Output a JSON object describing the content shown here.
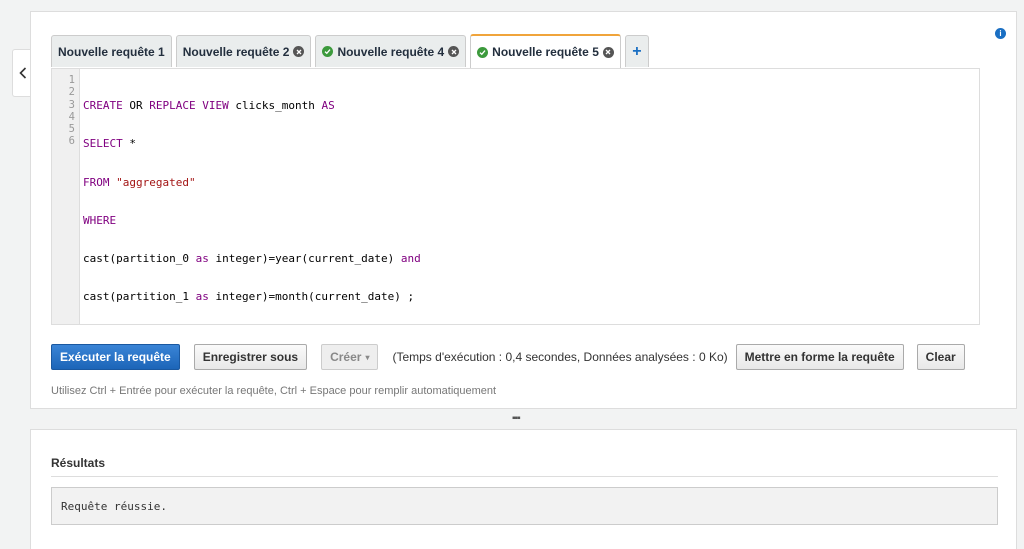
{
  "tabs": [
    {
      "label": "Nouvelle requête 1",
      "status": "none",
      "closable": false
    },
    {
      "label": "Nouvelle requête 2",
      "status": "none",
      "closable": true
    },
    {
      "label": "Nouvelle requête 4",
      "status": "success",
      "closable": true
    },
    {
      "label": "Nouvelle requête 5",
      "status": "success",
      "closable": true,
      "active": true
    }
  ],
  "add_tab_label": "+",
  "info_label": "i",
  "editor": {
    "line_numbers": [
      "1",
      "2",
      "3",
      "4",
      "5",
      "6"
    ],
    "lines": [
      "CREATE OR REPLACE VIEW clicks_month AS",
      "SELECT *",
      "FROM \"aggregated\"",
      "WHERE",
      "cast(partition_0 as integer)=year(current_date) and",
      "cast(partition_1 as integer)=month(current_date) ;"
    ]
  },
  "toolbar": {
    "run_label": "Exécuter la requête",
    "save_as_label": "Enregistrer sous",
    "create_label": "Créer",
    "exec_info": "(Temps d'exécution : 0,4 secondes, Données analysées : 0 Ko)",
    "format_label": "Mettre en forme la requête",
    "clear_label": "Clear"
  },
  "hint": "Utilisez Ctrl + Entrée pour exécuter la requête, Ctrl + Espace pour remplir automatiquement",
  "resize_handle": "▪▪▪",
  "results": {
    "title": "Résultats",
    "message": "Requête réussie."
  },
  "colors": {
    "primary": "#1c65b8",
    "active_tab_accent": "#f0a43b",
    "success": "#3c9a3c",
    "keyword": "#800080",
    "string": "#a31515"
  }
}
